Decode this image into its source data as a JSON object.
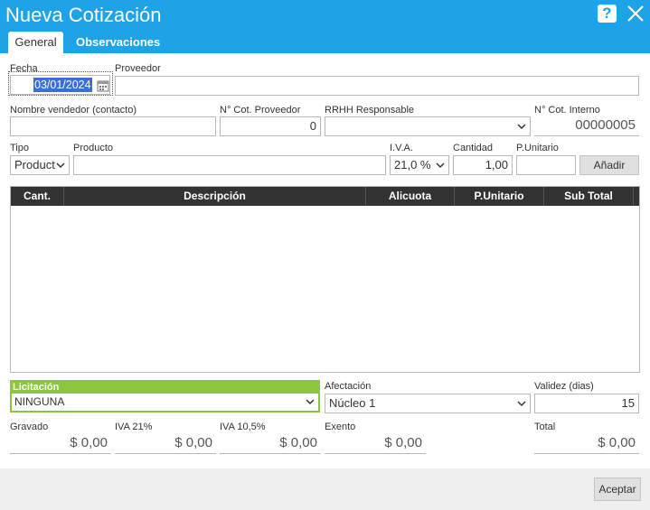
{
  "window": {
    "title": "Nueva Cotización"
  },
  "tabs": [
    {
      "label": "General",
      "active": true
    },
    {
      "label": "Observaciones",
      "active": false
    }
  ],
  "form": {
    "fecha": {
      "label": "Fecha",
      "value": "03/01/2024"
    },
    "proveedor": {
      "label": "Proveedor",
      "value": ""
    },
    "vendedor": {
      "label": "Nombre vendedor (contacto)",
      "value": ""
    },
    "cot_proveedor": {
      "label": "N° Cot. Proveedor",
      "value": "0"
    },
    "rrhh": {
      "label": "RRHH Responsable",
      "value": ""
    },
    "cot_interno": {
      "label": "N° Cot. Interno",
      "value": "00000005"
    },
    "tipo": {
      "label": "Tipo",
      "value": "Product"
    },
    "producto": {
      "label": "Producto",
      "value": ""
    },
    "iva": {
      "label": "I.V.A.",
      "value": "21,0 %"
    },
    "cantidad": {
      "label": "Cantidad",
      "value": "1,00"
    },
    "punitario": {
      "label": "P.Unitario",
      "value": ""
    },
    "add_label": "Añadir"
  },
  "grid": {
    "columns": [
      "Cant.",
      "Descripción",
      "Alicuota",
      "P.Unitario",
      "Sub Total"
    ],
    "rows": []
  },
  "bottom": {
    "licitacion": {
      "label": "Licitación",
      "value": "NINGUNA"
    },
    "afectacion": {
      "label": "Afectación",
      "value": "Núcleo 1"
    },
    "validez": {
      "label": "Validez (dias)",
      "value": "15"
    }
  },
  "totals": {
    "gravado": {
      "label": "Gravado",
      "value": "$ 0,00"
    },
    "iva21": {
      "label": "IVA 21%",
      "value": "$ 0,00"
    },
    "iva105": {
      "label": "IVA 10,5%",
      "value": "$ 0,00"
    },
    "exento": {
      "label": "Exento",
      "value": "$ 0,00"
    },
    "total": {
      "label": "Total",
      "value": "$ 0,00"
    }
  },
  "footer": {
    "accept_label": "Aceptar"
  },
  "colors": {
    "header": "#1fa3e8",
    "grid_header": "#333333",
    "licitacion": "#8cc63f",
    "selection": "#3a6fd8"
  }
}
